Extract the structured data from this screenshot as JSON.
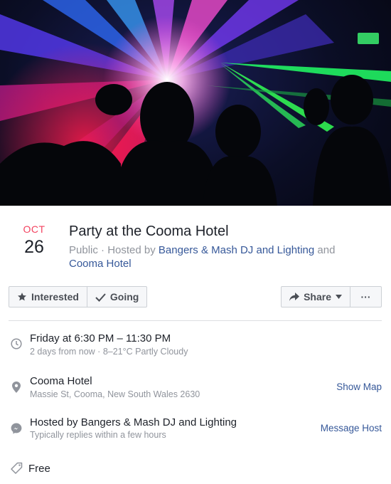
{
  "cover": {
    "alt_subject": "laser-light-show"
  },
  "event": {
    "month": "OCT",
    "day": "26",
    "title": "Party at the Cooma Hotel",
    "privacy": "Public",
    "hosted_by_prefix": "Hosted by",
    "host_primary": "Bangers & Mash DJ and Lighting",
    "and_word": "and",
    "host_secondary": "Cooma Hotel"
  },
  "actions": {
    "interested_label": "Interested",
    "going_label": "Going",
    "share_label": "Share",
    "more_label": "···"
  },
  "details": {
    "time_primary": "Friday at 6:30 PM – 11:30 PM",
    "time_secondary": "2 days from now · 8–21°C Partly Cloudy",
    "location_name": "Cooma Hotel",
    "location_address": "Massie St, Cooma, New South Wales 2630",
    "show_map_label": "Show Map",
    "host_line": "Hosted by Bangers & Mash DJ and Lighting",
    "host_reply": "Typically replies within a few hours",
    "message_host_label": "Message Host",
    "price": "Free"
  },
  "colors": {
    "accent_red": "#f3425f",
    "link_blue": "#365899",
    "muted": "#90949c"
  }
}
